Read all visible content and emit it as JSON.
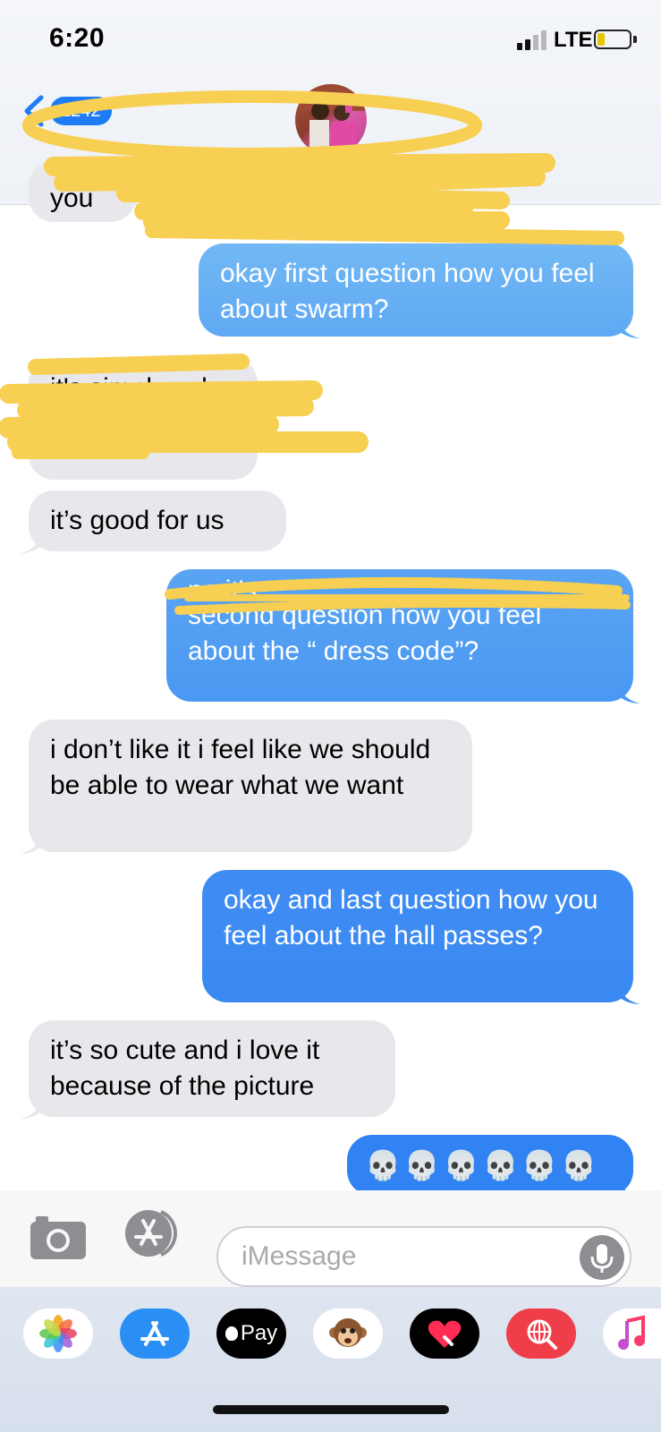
{
  "status_bar": {
    "time": "6:20",
    "network": "LTE"
  },
  "header": {
    "back_badge": "1242"
  },
  "messages": [
    {
      "side": "in",
      "text": "you"
    },
    {
      "side": "out",
      "text": "okay first question how you feel about swarm?"
    },
    {
      "side": "in",
      "text": "it's simply asl"
    },
    {
      "side": "in",
      "text": "it’s good for us"
    },
    {
      "side": "out",
      "text": "no it's..."
    },
    {
      "side": "out",
      "text": "second question how you feel about the “ dress code”?"
    },
    {
      "side": "in",
      "text": "i don’t like it i feel like we should be able to wear what we want"
    },
    {
      "side": "out",
      "text": "okay and last question how you feel about the hall passes?"
    },
    {
      "side": "in",
      "text": "it’s so cute and i love it because of the picture"
    },
    {
      "side": "out",
      "text": "💀💀💀💀💀💀"
    }
  ],
  "composer": {
    "placeholder": "iMessage"
  },
  "app_tray": {
    "items": [
      {
        "name": "photos-icon"
      },
      {
        "name": "app-store-icon"
      },
      {
        "name": "apple-pay-icon",
        "label": "Pay"
      },
      {
        "name": "animoji-icon"
      },
      {
        "name": "digital-touch-icon"
      },
      {
        "name": "web-images-icon"
      },
      {
        "name": "music-icon"
      }
    ]
  },
  "colors": {
    "incoming_bubble": "#e8e8ec",
    "outgoing_top": "#69b2f4",
    "outgoing_bottom": "#2f7ff2",
    "scribble": "#f7cf52",
    "accent": "#1f7cf6"
  }
}
